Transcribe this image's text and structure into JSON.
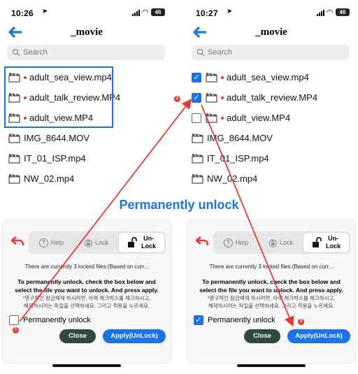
{
  "caption": "Permanently unlock",
  "panels": [
    {
      "status": {
        "time": "10:26",
        "battery": "46"
      },
      "title": "_movie",
      "search_placeholder": "Search",
      "files": [
        {
          "name": "adult_sea_view.mp4",
          "locked": true
        },
        {
          "name": "adult_talk_review.MP4",
          "locked": true
        },
        {
          "name": "adult_view.MP4",
          "locked": true
        },
        {
          "name": "IMG_8644.MOV",
          "locked": false
        },
        {
          "name": "IT_01_ISP.mp4",
          "locked": false
        },
        {
          "name": "NW_02.mp4",
          "locked": false
        }
      ],
      "sheet": {
        "help": "Help",
        "lock": "Lock",
        "unlock_top": "Un-",
        "unlock_bottom": "Lock",
        "info": "There are currently 3 locked files.(Based on curr...",
        "instr_1": "To permanently unlock, check the box below and",
        "instr_2": "select the file you want to unlock. And press apply.",
        "korean_1": "*영구적인 잠금해제 하시려면, 아래 체크박스를 체크하시고,",
        "korean_2": "해제하시려는 파일을 선택하세요. 그리고 적용을 누르세요.",
        "permanent_label": "Permanently unlock",
        "close": "Close",
        "apply": "Apply(UnLock)"
      }
    },
    {
      "status": {
        "time": "10:27",
        "battery": "46"
      },
      "title": "_movie",
      "search_placeholder": "Search",
      "files": [
        {
          "name": "adult_sea_view.mp4",
          "locked": true,
          "checked": true
        },
        {
          "name": "adult_talk_review.MP4",
          "locked": true,
          "checked": true
        },
        {
          "name": "adult_view.MP4",
          "locked": true,
          "checked": false
        },
        {
          "name": "IMG_8644.MOV",
          "locked": false,
          "checked": false
        },
        {
          "name": "IT_01_ISP.mp4",
          "locked": false,
          "checked": false
        },
        {
          "name": "NW_02.mp4",
          "locked": false,
          "checked": false
        }
      ],
      "sheet": {
        "help": "Help",
        "lock": "Lock",
        "unlock_top": "Un-",
        "unlock_bottom": "Lock",
        "info": "There are currently 3 locked files.(Based on curr...",
        "instr_1": "To permanently unlock, check the box below and",
        "instr_2": "select the file you want to unlock. And press apply.",
        "korean_1": "*영구적인 잠금해제 하시려면, 아래 체크박스를 체크하시고,",
        "korean_2": "해제하시려는 파일을 선택하세요. 그리고 적용을 누르세요.",
        "permanent_label": "Permanently unlock",
        "permanent_checked": true,
        "close": "Close",
        "apply": "Apply(UnLock)"
      }
    }
  ],
  "steps": [
    "1",
    "2",
    "3"
  ],
  "colors": {
    "accent": "#1a73e8",
    "annotation": "#e53935",
    "close_button": "#2d4a3f"
  },
  "icons": [
    "back-arrow-icon",
    "search-icon",
    "film-icon",
    "undo-icon",
    "help-icon",
    "lock-icon",
    "unlock-icon",
    "checkbox-icon"
  ]
}
